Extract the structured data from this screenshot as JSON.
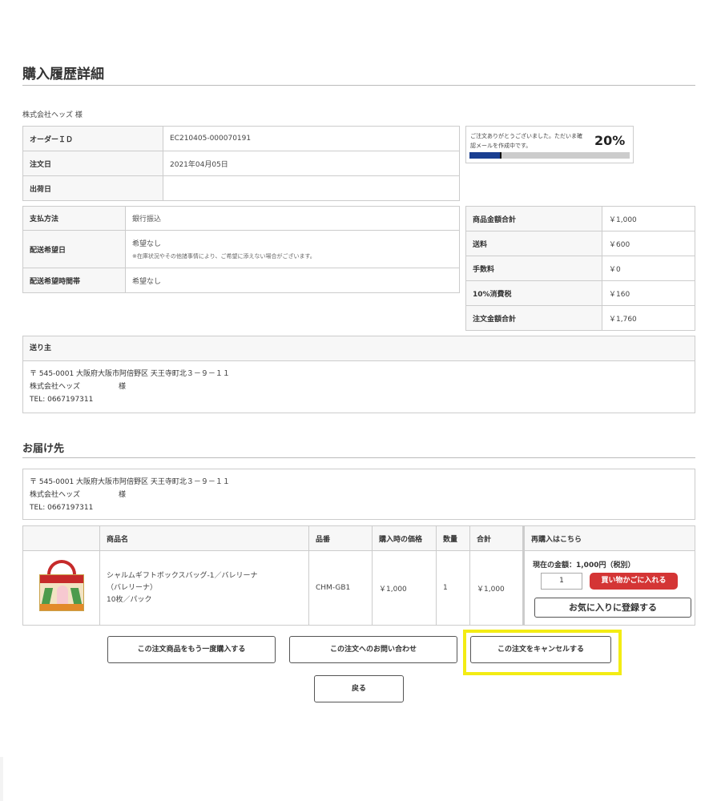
{
  "page_title": "購入履歴詳細",
  "customer_name": "株式会社ヘッズ 様",
  "order": {
    "rows": [
      {
        "label": "オーダーＩＤ",
        "value": "EC210405-000070191"
      },
      {
        "label": "注文日",
        "value": "2021年04月05日"
      },
      {
        "label": "出荷日",
        "value": ""
      }
    ]
  },
  "progress": {
    "message": "ご注文ありがとうございました。ただいま確認メールを作成中です。",
    "percent_label": "20%",
    "percent": 20
  },
  "payment": {
    "method_label": "支払方法",
    "method_value": "銀行振込",
    "date_label": "配送希望日",
    "date_value": "希望なし",
    "date_note": "※在庫状況やその他諸事情により、ご希望に添えない場合がございます。",
    "time_label": "配送希望時間帯",
    "time_value": "希望なし"
  },
  "summary": {
    "rows": [
      {
        "label": "商品金額合計",
        "value": "￥1,000"
      },
      {
        "label": "送料",
        "value": "￥600"
      },
      {
        "label": "手数料",
        "value": "￥0"
      },
      {
        "label": "10%消費税",
        "value": "￥160"
      },
      {
        "label": "注文金額合計",
        "value": "￥1,760"
      }
    ]
  },
  "sender": {
    "heading": "送り主",
    "address": "〒 545-0001 大阪府大阪市阿倍野区 天王寺町北３－９－１１",
    "company": "株式会社ヘッズ",
    "honorific": "様",
    "tel": "TEL: 0667197311"
  },
  "delivery": {
    "heading": "お届け先",
    "address": "〒 545-0001 大阪府大阪市阿倍野区 天王寺町北３－９－１１",
    "company": "株式会社ヘッズ",
    "honorific": "様",
    "tel": "TEL: 0667197311"
  },
  "items": {
    "headers": {
      "name": "商品名",
      "code": "品番",
      "price": "購入時の価格",
      "qty": "数量",
      "total": "合計",
      "rebuy": "再購入はこちら"
    },
    "rows": [
      {
        "name_line1": "シャルムギフトボックスバッグ-1／バレリーナ",
        "name_line2": "（バレリーナ）",
        "name_line3": "10枚／パック",
        "code": "CHM-GB1",
        "price": "￥1,000",
        "qty": "1",
        "total": "￥1,000",
        "current_price": "現在の金額：1,000円（税別）",
        "qty_input": "1",
        "cart_button": "買い物かごに入れる",
        "favorite_button": "お気に入りに登録する"
      }
    ]
  },
  "actions": {
    "reorder": "この注文商品をもう一度購入する",
    "inquiry": "この注文へのお問い合わせ",
    "cancel": "この注文をキャンセルする",
    "back": "戻る"
  },
  "colors": {
    "accent_red": "#d43535",
    "progress_blue": "#1a3f91",
    "highlight_yellow": "#f3ec14"
  }
}
